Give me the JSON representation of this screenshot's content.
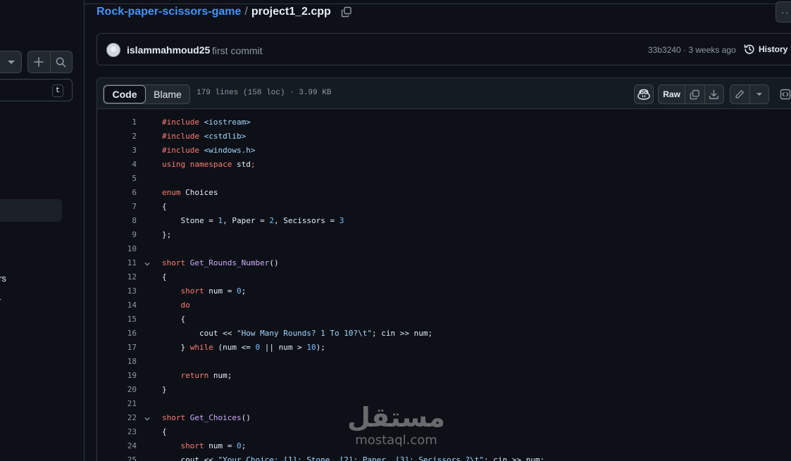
{
  "breadcrumb": {
    "repo": "Rock-paper-scissors-game",
    "separator": "/",
    "file": "project1_2.cpp"
  },
  "sidebar": {
    "filter_shortcut": "t",
    "items": [
      {
        "label": "rs"
      },
      {
        "label": "r"
      }
    ]
  },
  "commit": {
    "author": "islammahmoud25",
    "message": "first commit",
    "meta": "33b3240 · 3 weeks ago",
    "history_label": "History"
  },
  "file_header": {
    "tabs": [
      {
        "label": "Code",
        "active": true
      },
      {
        "label": "Blame",
        "active": false
      }
    ],
    "stats": "179 lines (158 loc) · 3.99 KB",
    "raw_label": "Raw"
  },
  "code_lines": [
    {
      "n": "1",
      "fold": false,
      "parts": [
        [
          "kw",
          "#include "
        ],
        [
          "hd",
          "<iostream>"
        ]
      ]
    },
    {
      "n": "2",
      "fold": false,
      "parts": [
        [
          "kw",
          "#include "
        ],
        [
          "hd",
          "<cstdlib>"
        ]
      ]
    },
    {
      "n": "3",
      "fold": false,
      "parts": [
        [
          "kw",
          "#include "
        ],
        [
          "hd",
          "<windows.h>"
        ]
      ]
    },
    {
      "n": "4",
      "fold": false,
      "parts": [
        [
          "kw",
          "using namespace "
        ],
        [
          "",
          "std"
        ],
        [
          "kw",
          ";"
        ]
      ]
    },
    {
      "n": "5",
      "fold": false,
      "parts": []
    },
    {
      "n": "6",
      "fold": false,
      "parts": [
        [
          "kw",
          "enum "
        ],
        [
          "",
          "Choices"
        ]
      ]
    },
    {
      "n": "7",
      "fold": false,
      "parts": [
        [
          "",
          "{"
        ]
      ]
    },
    {
      "n": "8",
      "fold": false,
      "parts": [
        [
          "",
          "    Stone = "
        ],
        [
          "nm",
          "1"
        ],
        [
          "",
          ", Paper = "
        ],
        [
          "nm",
          "2"
        ],
        [
          "",
          ", Secissors = "
        ],
        [
          "nm",
          "3"
        ]
      ]
    },
    {
      "n": "9",
      "fold": false,
      "parts": [
        [
          "",
          "};"
        ]
      ]
    },
    {
      "n": "10",
      "fold": false,
      "parts": []
    },
    {
      "n": "11",
      "fold": true,
      "parts": [
        [
          "kw",
          "short "
        ],
        [
          "fn",
          "Get_Rounds_Number"
        ],
        [
          "",
          "()"
        ]
      ]
    },
    {
      "n": "12",
      "fold": false,
      "parts": [
        [
          "",
          "{"
        ]
      ]
    },
    {
      "n": "13",
      "fold": false,
      "parts": [
        [
          "",
          "    "
        ],
        [
          "kw",
          "short "
        ],
        [
          "",
          "num = "
        ],
        [
          "nm",
          "0"
        ],
        [
          "",
          ";"
        ]
      ]
    },
    {
      "n": "14",
      "fold": false,
      "parts": [
        [
          "",
          "    "
        ],
        [
          "kw",
          "do"
        ]
      ]
    },
    {
      "n": "15",
      "fold": false,
      "parts": [
        [
          "",
          "    {"
        ]
      ]
    },
    {
      "n": "16",
      "fold": false,
      "parts": [
        [
          "",
          "        cout << "
        ],
        [
          "st",
          "\"How Many Rounds? 1 To 10?\\t\""
        ],
        [
          "",
          "; cin >> num;"
        ]
      ]
    },
    {
      "n": "17",
      "fold": false,
      "parts": [
        [
          "",
          "    } "
        ],
        [
          "kw",
          "while "
        ],
        [
          "",
          "(num <= "
        ],
        [
          "nm",
          "0"
        ],
        [
          "",
          " || num > "
        ],
        [
          "nm",
          "10"
        ],
        [
          "",
          ");"
        ]
      ]
    },
    {
      "n": "18",
      "fold": false,
      "parts": []
    },
    {
      "n": "19",
      "fold": false,
      "parts": [
        [
          "",
          "    "
        ],
        [
          "kw",
          "return "
        ],
        [
          "",
          "num;"
        ]
      ]
    },
    {
      "n": "20",
      "fold": false,
      "parts": [
        [
          "",
          "}"
        ]
      ]
    },
    {
      "n": "21",
      "fold": false,
      "parts": []
    },
    {
      "n": "22",
      "fold": true,
      "parts": [
        [
          "kw",
          "short "
        ],
        [
          "fn",
          "Get_Choices"
        ],
        [
          "",
          "()"
        ]
      ]
    },
    {
      "n": "23",
      "fold": false,
      "parts": [
        [
          "",
          "{"
        ]
      ]
    },
    {
      "n": "24",
      "fold": false,
      "parts": [
        [
          "",
          "    "
        ],
        [
          "kw",
          "short "
        ],
        [
          "",
          "num = "
        ],
        [
          "nm",
          "0"
        ],
        [
          "",
          ";"
        ]
      ]
    },
    {
      "n": "25",
      "fold": false,
      "parts": [
        [
          "",
          "    cout << "
        ],
        [
          "st",
          "\"Your Choice: [1]: Stone, [2]: Paper, [3]: Secissors ?\\t\""
        ],
        [
          "",
          "; cin >> num;"
        ]
      ]
    }
  ],
  "watermark": {
    "arabic": "مستقل",
    "latin": "mostaql.com"
  },
  "colors": {
    "background": "#0d1117",
    "link": "#4493f8",
    "keyword": "#ff7b72",
    "function": "#d2a8ff",
    "string": "#a5d6ff",
    "number": "#79c0ff"
  },
  "icons": [
    "chevron-down-icon",
    "plus-icon",
    "search-icon",
    "copy-icon",
    "kebab-icon",
    "history-icon",
    "copilot-icon",
    "download-icon",
    "pencil-icon",
    "symbols-icon"
  ]
}
